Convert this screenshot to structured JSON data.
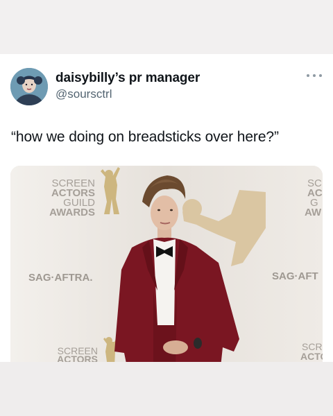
{
  "tweet": {
    "display_name": "daisybilly’s pr manager",
    "handle": "@soursctrl",
    "text": "“how we doing on breadsticks over here?”",
    "more_icon": "more-horizontal-icon"
  },
  "media": {
    "backdrop_left_logo": [
      "SCREEN",
      "ACTORS",
      "GUILD",
      "AWARDS"
    ],
    "backdrop_left_brand": "SAG·AFTRA.",
    "backdrop_right_brand": "SAG·AFT",
    "backdrop_right_logo": [
      "SC",
      "AC",
      "G",
      "AW"
    ],
    "backdrop_bottom_left": [
      "SCREEN",
      "ACTORS"
    ],
    "backdrop_bottom_right": [
      "SCRE",
      "ACTO"
    ]
  },
  "colors": {
    "name": "#0f1419",
    "handle": "#536471",
    "suit": "#7a1622",
    "backdrop": "#eae6e1",
    "logo_gold": "#c9b07a"
  }
}
